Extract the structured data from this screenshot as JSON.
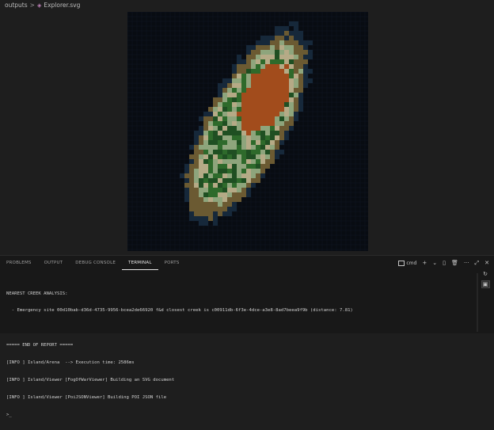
{
  "breadcrumb": {
    "folder": "outputs",
    "separator": ">",
    "file": "Explorer.svg"
  },
  "panel": {
    "tabs": [
      {
        "label": "PROBLEMS"
      },
      {
        "label": "OUTPUT"
      },
      {
        "label": "DEBUG CONSOLE"
      },
      {
        "label": "TERMINAL",
        "active": true
      },
      {
        "label": "PORTS"
      }
    ],
    "terminal_name": "cmd",
    "actions": {
      "add": "+",
      "dropdown": "⌄",
      "split": "▯",
      "trash": "🗑",
      "more": "···",
      "maximize": "⤢",
      "close": "✕"
    }
  },
  "terminal": {
    "lines": [
      "NEAREST CREEK ANALYSIS:",
      "  - Emergency site 00d10bab-d36d-4735-9956-bcea2de66920 f&d closest creek is c00911db-6f3e-4dce-a3e8-8ad7beea9f9b (distance: 7.81)",
      "",
      "===== END OF REPORT =====",
      "[INFO ] Island/Arena  --> Execution time: 2586ms",
      "[INFO ] Island/Viewer [FogOfWarViewer] Building an SVG document",
      "[INFO ] Island/Viewer [PoiJSONViewer] Building POI JSON file",
      ">_"
    ]
  },
  "colors": {
    "ocean": "#0c1826",
    "shallow": "#16283a",
    "beach": "#6b5a32",
    "sand": "#b5aa86",
    "grass": "#8ea57c",
    "forest": "#2e6a2b",
    "darkforest": "#1f4f22",
    "mountain": "#a24c1c"
  }
}
